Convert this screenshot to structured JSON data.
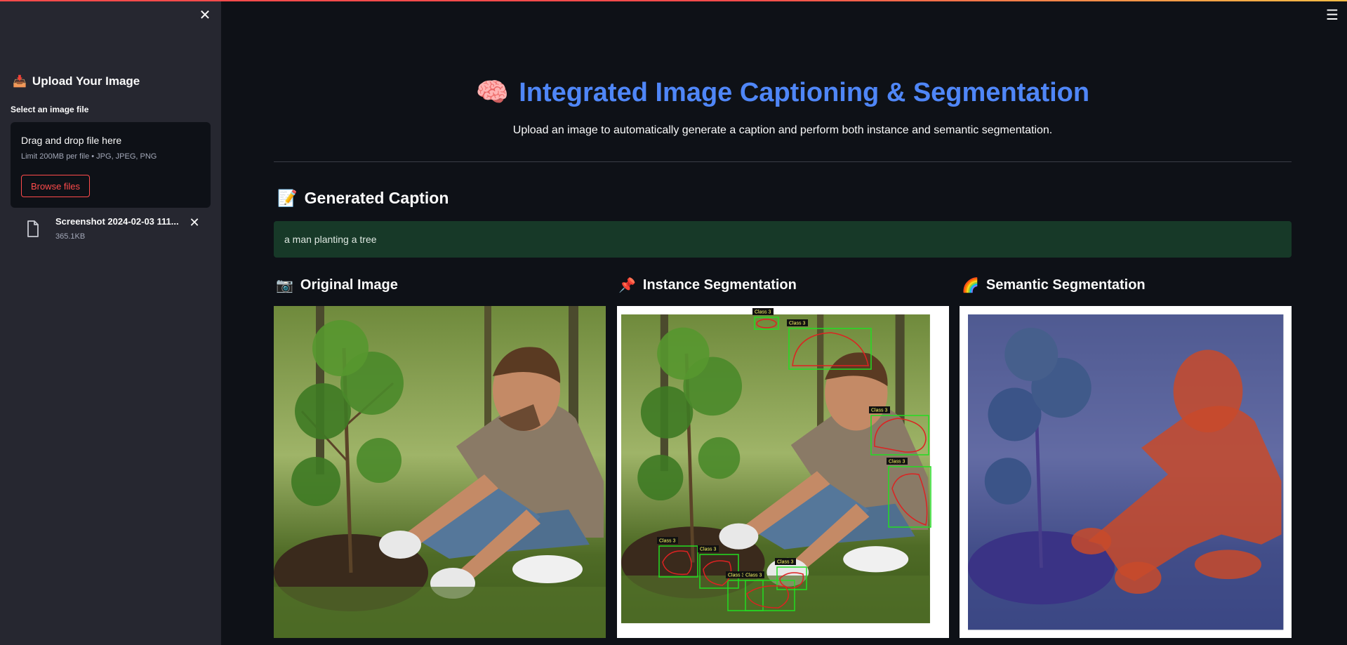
{
  "sidebar": {
    "header": "Upload Your Image",
    "header_icon": "inbox-tray-icon",
    "file_label": "Select an image file",
    "dropzone": {
      "title": "Drag and drop file here",
      "limit": "Limit 200MB per file • JPG, JPEG, PNG",
      "browse_label": "Browse files"
    },
    "file": {
      "name": "Screenshot 2024-02-03 111...",
      "size": "365.1KB"
    }
  },
  "main": {
    "title": "Integrated Image Captioning & Segmentation",
    "title_icon": "brain-icon",
    "subtitle": "Upload an image to automatically generate a caption and perform both instance and semantic segmentation.",
    "caption_section": {
      "heading": "Generated Caption",
      "icon": "memo-icon",
      "caption": "a man planting a tree"
    },
    "columns": [
      {
        "heading": "Original Image",
        "icon": "camera-icon"
      },
      {
        "heading": "Instance Segmentation",
        "icon": "pushpin-icon"
      },
      {
        "heading": "Semantic Segmentation",
        "icon": "rainbow-icon"
      }
    ],
    "instance_labels": [
      "Class 3",
      "Class 3",
      "Class 3",
      "Class 3",
      "Class 3",
      "Class 3",
      "Class 3",
      "Class 3",
      "Class 3"
    ]
  },
  "colors": {
    "accent": "#ff4b4b",
    "title": "#4f86f7",
    "success_bg": "#173928",
    "box": "#22dd22",
    "mask": "#dd2222"
  }
}
